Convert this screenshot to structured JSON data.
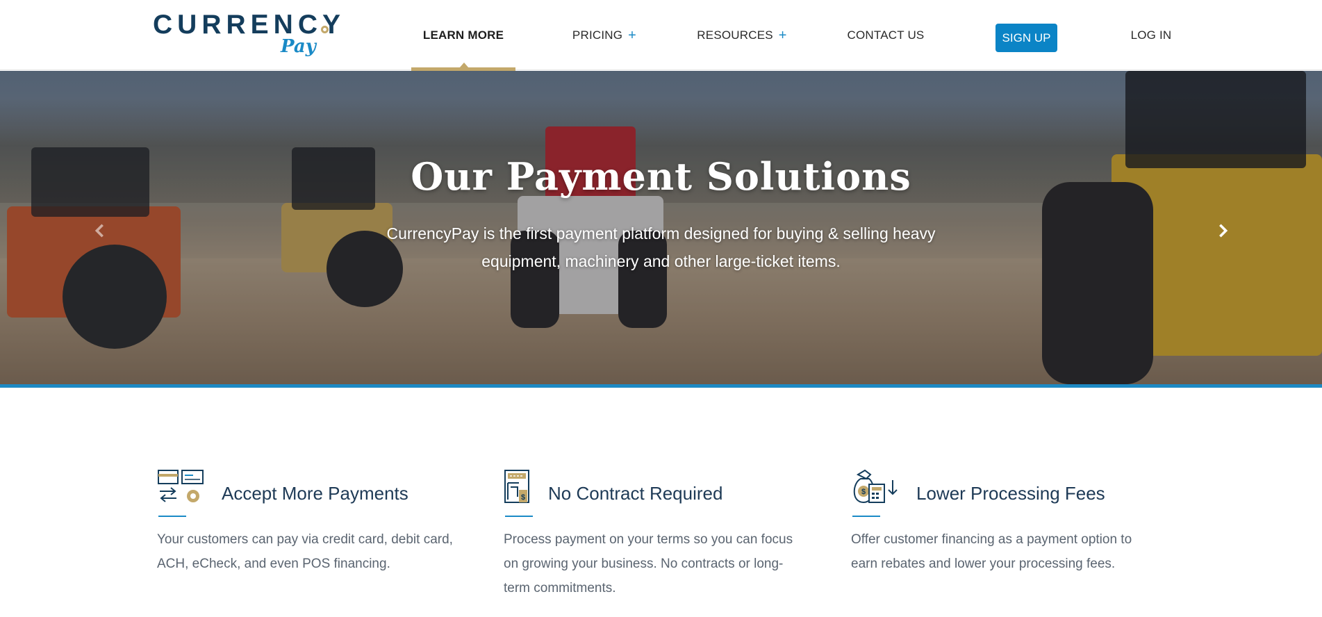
{
  "header": {
    "logo": {
      "word": "CURRENCY",
      "sub": "Pay"
    },
    "nav": [
      {
        "label": "LEARN MORE",
        "has_plus": false,
        "active": true
      },
      {
        "label": "PRICING",
        "has_plus": true,
        "active": false
      },
      {
        "label": "RESOURCES",
        "has_plus": true,
        "active": false
      },
      {
        "label": "CONTACT US",
        "has_plus": false,
        "active": false
      }
    ],
    "signup_label": "SIGN UP",
    "login_label": "LOG IN",
    "plus_glyph": "+"
  },
  "hero": {
    "title": "Our Payment Solutions",
    "subtitle": "CurrencyPay is the first payment platform designed for buying & selling heavy equipment, machinery and other large-ticket items.",
    "prev_icon": "chevron-left-icon",
    "next_icon": "chevron-right-icon"
  },
  "features": [
    {
      "icon": "payment-methods-icon",
      "title": "Accept More Payments",
      "text": "Your customers can pay via credit card, debit card, ACH, eCheck, and even POS financing."
    },
    {
      "icon": "contract-document-icon",
      "title": "No Contract Required",
      "text": "Process payment on your terms so you can focus on growing your business. No contracts or long-term commitments."
    },
    {
      "icon": "money-bag-calculator-icon",
      "title": "Lower Processing Fees",
      "text": "Offer customer financing as a payment option to earn rebates and lower your processing fees."
    }
  ],
  "colors": {
    "brand_navy": "#143d5c",
    "brand_blue": "#0b84c6",
    "accent_gold": "#c3a86a",
    "body_text": "#5a6470"
  }
}
